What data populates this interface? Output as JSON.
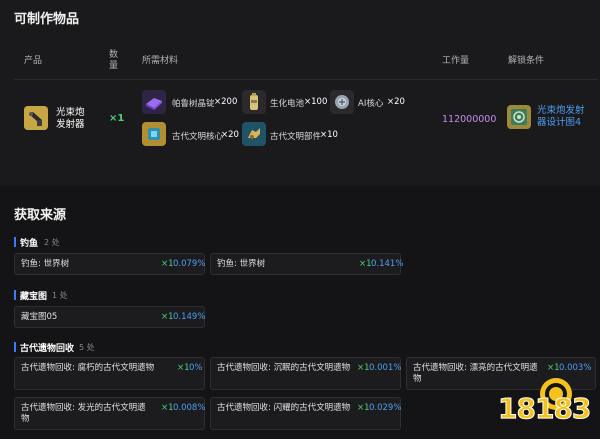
{
  "craft": {
    "title": "可制作物品",
    "headers": {
      "product": "产品",
      "quantity": "数\n量",
      "materials": "所需材料",
      "workload": "工作量",
      "unlock": "解锁条件"
    },
    "product": {
      "name": "光束炮\n发射器",
      "quantity": "×1",
      "icon": "cannon-icon"
    },
    "materials": [
      {
        "name": "帕鲁树晶锭",
        "qty": "×200",
        "icon": "crystal-ingot-icon"
      },
      {
        "name": "生化电池",
        "qty": "×100",
        "icon": "battery-icon"
      },
      {
        "name": "AI核心",
        "qty": "×20",
        "icon": "ai-core-icon"
      },
      {
        "name": "古代文明核心",
        "qty": "×20",
        "icon": "ancient-core-icon"
      },
      {
        "name": "古代文明部件",
        "qty": "×10",
        "icon": "ancient-part-icon"
      }
    ],
    "workload": "112000000",
    "unlock": {
      "text": "光束炮发射\n器设计图4",
      "icon": "blueprint-icon"
    }
  },
  "sources": {
    "title": "获取来源",
    "groups": [
      {
        "label": "钓鱼",
        "count": "2 处",
        "items": [
          {
            "name": "钓鱼: 世界树",
            "qty": "×1",
            "pct": "0.079%"
          },
          {
            "name": "钓鱼: 世界树",
            "qty": "×1",
            "pct": "0.141%"
          }
        ]
      },
      {
        "label": "藏宝图",
        "count": "1 处",
        "items": [
          {
            "name": "藏宝图05",
            "qty": "×1",
            "pct": "0.149%"
          }
        ]
      },
      {
        "label": "古代遗物回收",
        "count": "5 处",
        "items": [
          {
            "name": "古代遗物回收: 腐朽的古代文明遗物",
            "qty": "×1",
            "pct": "0%"
          },
          {
            "name": "古代遗物回收: 沉眠的古代文明遗物",
            "qty": "×1",
            "pct": "0.001%"
          },
          {
            "name": "古代遗物回收: 漂亮的古代文明遗\n物",
            "qty": "×1",
            "pct": "0.003%"
          },
          {
            "name": "古代遗物回收: 发光的古代文明遗\n物",
            "qty": "×1",
            "pct": "0.008%"
          },
          {
            "name": "古代遗物回收: 闪耀的古代文明遗物",
            "qty": "×1",
            "pct": "0.029%"
          }
        ]
      }
    ]
  },
  "watermark": "18183",
  "colors": {
    "accent": "#3a7bff",
    "green": "#4ccf78",
    "purple": "#c48cf0",
    "link": "#4d9ff0"
  }
}
